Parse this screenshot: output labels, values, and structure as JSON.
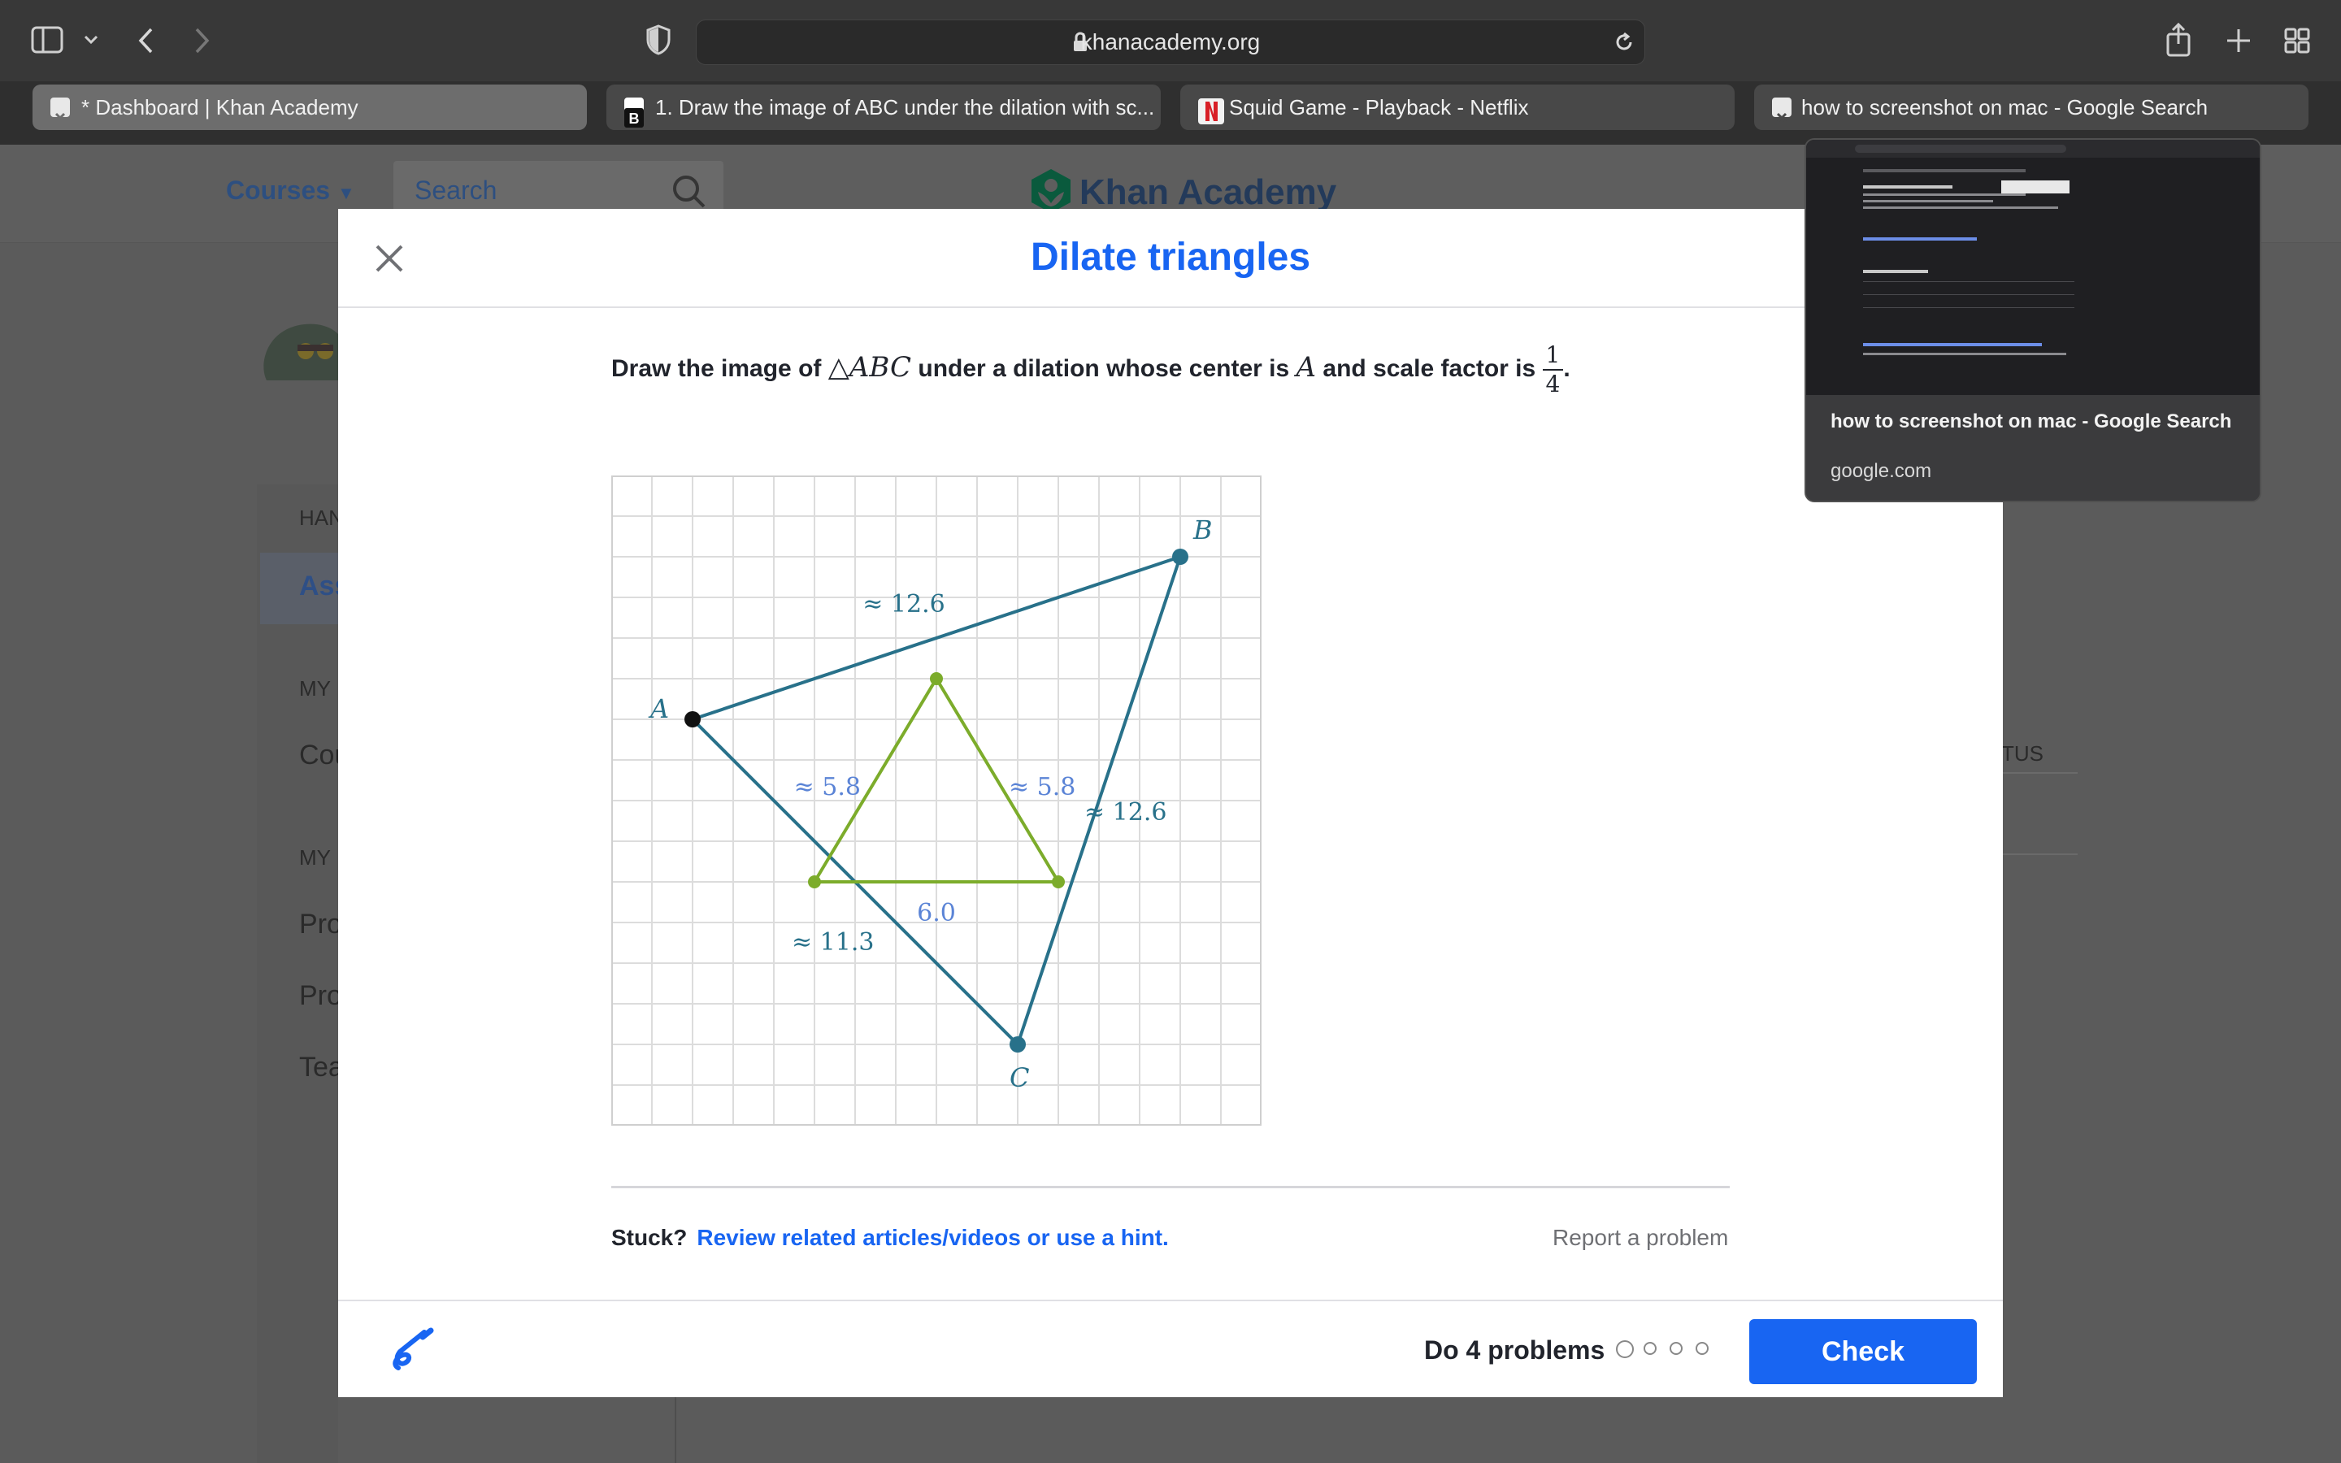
{
  "browser": {
    "url": "khanacademy.org",
    "tabs": [
      {
        "label": "* Dashboard | Khan Academy",
        "active": true
      },
      {
        "label": "1. Draw the image of ABC under the dilation with sc..."
      },
      {
        "label": "Squid Game - Playback - Netflix"
      },
      {
        "label": "how to screenshot on mac - Google Search"
      }
    ],
    "preview": {
      "title": "how to screenshot on mac - Google Search",
      "domain": "google.com"
    }
  },
  "site": {
    "courses_label": "Courses",
    "search_placeholder": "Search",
    "brand": "Khan Academy",
    "sidebar": [
      "HAN",
      "Ass",
      "MY",
      "Cou",
      "MY",
      "Pro",
      "Pro",
      "Tea"
    ],
    "status_fragment": "TUS"
  },
  "modal": {
    "title": "Dilate triangles",
    "question": {
      "part1": "Draw the image of ",
      "triangle": "△ABC",
      "part2": " under a dilation whose center is ",
      "center": "A",
      "part3": " and scale factor is ",
      "frac_num": "1",
      "frac_den": "4",
      "end": "."
    },
    "stuck_label": "Stuck?",
    "hint_link": "Review related articles/videos or use a hint.",
    "report": "Report a problem",
    "do_problems": "Do 4 problems",
    "check": "Check"
  },
  "graph": {
    "grid_columns": 16,
    "grid_rows": 16,
    "colors": {
      "original": "#28718a",
      "image": "#7cac2b",
      "center": "#111111",
      "grid": "#dcdcdc"
    },
    "points": [
      {
        "name": "A",
        "x": 2,
        "y": 10
      },
      {
        "name": "B",
        "x": 14,
        "y": 14
      },
      {
        "name": "C",
        "x": 10,
        "y": 2
      }
    ],
    "image_points": [
      {
        "x": 8,
        "y": 11
      },
      {
        "x": 5,
        "y": 6
      },
      {
        "x": 11,
        "y": 6
      }
    ],
    "labels": {
      "AB": "≈ 12.6",
      "BC": "≈ 12.6",
      "AC": "≈ 11.3",
      "img_left": "≈ 5.8",
      "img_right": "≈ 5.8",
      "img_bottom": "6.0"
    }
  }
}
